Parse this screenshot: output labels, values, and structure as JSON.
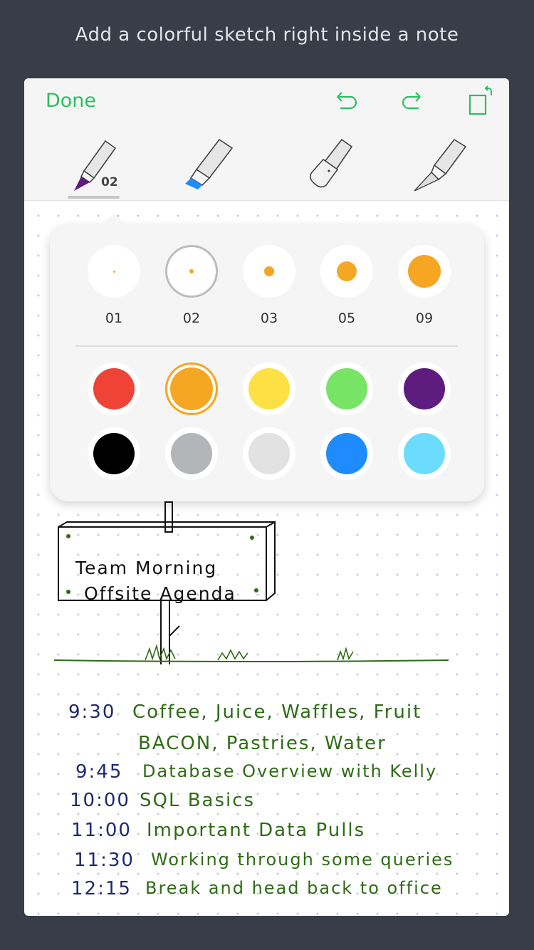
{
  "caption": "Add a colorful sketch right inside a note",
  "header": {
    "done_label": "Done",
    "icons": [
      "undo-icon",
      "redo-icon",
      "rotate-icon"
    ]
  },
  "tools": {
    "selected": "marker",
    "selected_size": "02",
    "items": [
      "pen-tool",
      "highlighter-tool",
      "eraser-tool",
      "cutter-tool"
    ],
    "pen_color": "#5e1c7e",
    "highlighter_color": "#1e8cff"
  },
  "popover": {
    "sizes": [
      {
        "label": "01"
      },
      {
        "label": "02",
        "selected": true
      },
      {
        "label": "03"
      },
      {
        "label": "05"
      },
      {
        "label": "09"
      }
    ],
    "colors": [
      {
        "name": "red",
        "hex": "#f04338"
      },
      {
        "name": "orange",
        "hex": "#f5a623",
        "selected": true
      },
      {
        "name": "yellow",
        "hex": "#fce044"
      },
      {
        "name": "green",
        "hex": "#78e466"
      },
      {
        "name": "purple",
        "hex": "#5e1c7e"
      },
      {
        "name": "black",
        "hex": "#000000"
      },
      {
        "name": "gray",
        "hex": "#b4b5b8"
      },
      {
        "name": "light-gray",
        "hex": "#e2e2e2"
      },
      {
        "name": "blue",
        "hex": "#1e8cff"
      },
      {
        "name": "light-blue",
        "hex": "#6cdcfc"
      }
    ]
  },
  "sketch": {
    "sign_line1": "Team Morning",
    "sign_line2": "Offsite Agenda",
    "agenda": [
      {
        "time": "9:30",
        "item": "Coffee, Juice, Waffles, Fruit"
      },
      {
        "time": "",
        "item": "BACON,  Pastries, Water"
      },
      {
        "time": "9:45",
        "item": "Database  Overview  with  Kelly"
      },
      {
        "time": "10:00",
        "item": "SQL Basics"
      },
      {
        "time": "11:00",
        "item": "Important  Data  Pulls"
      },
      {
        "time": "11:30",
        "item": "Working  through  some  queries"
      },
      {
        "time": "12:15",
        "item": "Break and head  back   to  office"
      }
    ]
  }
}
